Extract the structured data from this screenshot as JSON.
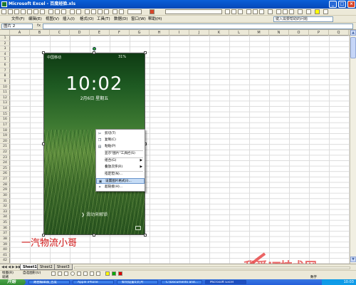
{
  "window": {
    "title": "Microsoft Excel - 百度经验.xls",
    "controls": [
      "_",
      "□",
      "×"
    ]
  },
  "menu": {
    "items": [
      "文件(F)",
      "编辑(E)",
      "视图(V)",
      "插入(I)",
      "格式(O)",
      "工具(T)",
      "数据(D)",
      "窗口(W)",
      "帮助(H)"
    ],
    "help_placeholder": "键入需要帮助的问题"
  },
  "formula_bar": {
    "name_box": "图片 2",
    "fx": "fx"
  },
  "columns": [
    "A",
    "B",
    "C",
    "D",
    "E",
    "F",
    "G",
    "H",
    "I",
    "J",
    "K",
    "L",
    "M",
    "N",
    "O",
    "P",
    "Q"
  ],
  "rows": [
    "1",
    "2",
    "3",
    "4",
    "5",
    "6",
    "7",
    "8",
    "9",
    "10",
    "11",
    "12",
    "13",
    "14",
    "15",
    "16",
    "17",
    "18",
    "19",
    "20",
    "21",
    "22",
    "23",
    "24",
    "25",
    "26",
    "27",
    "28",
    "29",
    "30",
    "31",
    "32",
    "33",
    "34",
    "35",
    "36",
    "37",
    "38",
    "39",
    "40",
    "41",
    "42"
  ],
  "picture": {
    "carrier": "中国移动",
    "battery": "31%",
    "time": "10:02",
    "date": "2月6日 星期五",
    "unlock_text": "滑动来解锁"
  },
  "context_menu": {
    "items": [
      {
        "label": "剪切(T)",
        "icon": "scissors-icon",
        "submenu": false,
        "highlighted": false
      },
      {
        "label": "复制(C)",
        "icon": "copy-icon",
        "submenu": false,
        "highlighted": false
      },
      {
        "label": "粘贴(P)",
        "icon": "paste-icon",
        "submenu": false,
        "highlighted": false
      },
      {
        "label": "显示\"图片\"工具栏(S)",
        "icon": "",
        "submenu": false,
        "highlighted": false
      },
      {
        "label": "组合(G)",
        "icon": "",
        "submenu": true,
        "highlighted": false
      },
      {
        "label": "叠放次序(R)",
        "icon": "",
        "submenu": true,
        "highlighted": false
      },
      {
        "label": "指定宏(N)...",
        "icon": "",
        "submenu": false,
        "highlighted": false
      },
      {
        "label": "设置图片格式(I)...",
        "icon": "format-picture-icon",
        "submenu": false,
        "highlighted": true
      },
      {
        "label": "超链接(H)...",
        "icon": "hyperlink-icon",
        "submenu": false,
        "highlighted": false
      }
    ]
  },
  "signature": "一汽物流小哥",
  "sheet_tabs": [
    "Sheet1",
    "Sheet2",
    "Sheet3"
  ],
  "draw_bar": {
    "draw_label": "绘图(R)",
    "autoshapes_label": "自选图形(U)"
  },
  "status": {
    "left": "就绪",
    "right": "数字"
  },
  "taskbar": {
    "start": "开始",
    "tasks": [
      "路由编辑器_百度",
      "Apple iPhone",
      "如何设置幻灯片",
      "C:\\Documents and...",
      "Microsoft Excel"
    ],
    "clock": "10:03"
  },
  "watermark": "我爱IT技术网",
  "colors": {
    "title_blue": "#0548b7",
    "menu_bg": "#ece9d8",
    "signature_red": "#d01010",
    "highlight": "#c6dcf5"
  }
}
